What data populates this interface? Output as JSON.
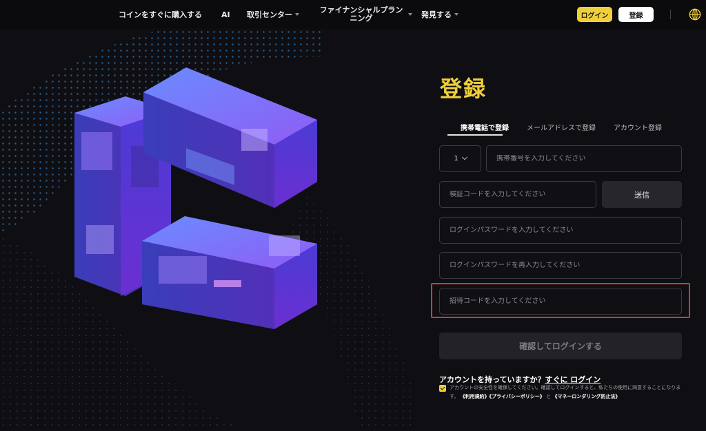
{
  "nav": {
    "buy_crypto": "コインをすぐに購入する",
    "ai": "AI",
    "trade_center": "取引センター",
    "financial": "ファイナンシャルプランニング",
    "discover": "発見する",
    "login": "ログイン",
    "register": "登録"
  },
  "form": {
    "title": "登録",
    "tabs": [
      {
        "label": "携帯電話で登録",
        "active": true
      },
      {
        "label": "メールアドレスで登録",
        "active": false
      },
      {
        "label": "アカウント登録",
        "active": false
      }
    ],
    "country_code": "1",
    "phone_placeholder": "携帯番号を入力してください",
    "code_placeholder": "検証コードを入力してください",
    "send_label": "送信",
    "password_placeholder": "ログインパスワードを入力してください",
    "password_confirm_placeholder": "ログインパスワードを再入力してください",
    "invite_placeholder": "招待コードを入力してください",
    "submit_label": "確認してログインする",
    "have_account_text": "アカウントを持っていますか？",
    "login_now": "すぐに ログイン",
    "agree_text": "アカウントの安全性を確保してください。確認してログインすると、私たちの使用に同意することになります。",
    "terms": "《利用規約》",
    "privacy": "《プライバシーポリシー》",
    "and": "と",
    "aml": "《マネーロンダリング防止法》"
  },
  "colors": {
    "accent": "#f0d03a",
    "highlight": "#e0352a",
    "background": "#0f0f13"
  }
}
